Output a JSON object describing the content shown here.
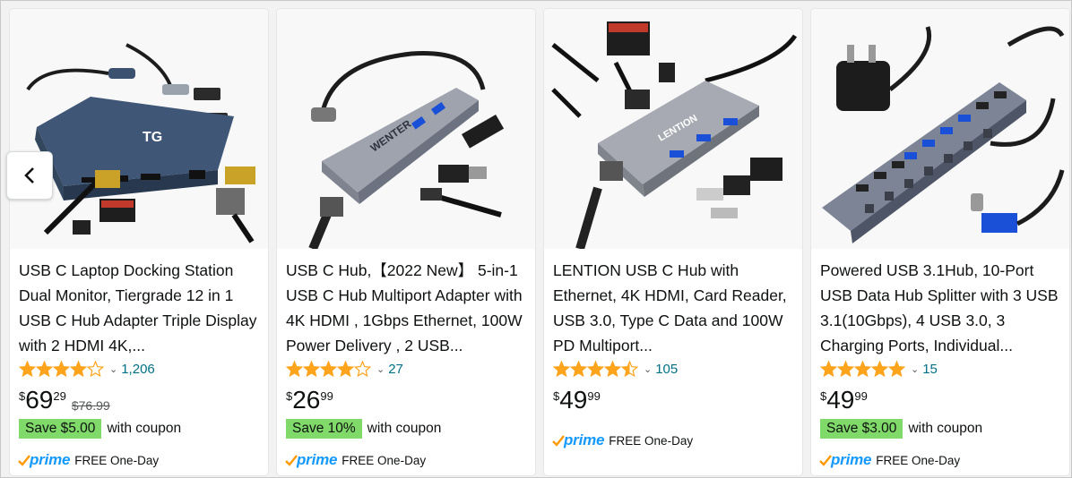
{
  "carousel": {
    "prev_icon": "chevron-left-icon",
    "products": [
      {
        "title": "USB C Laptop Docking Station Dual Monitor, Tiergrade 12 in 1 USB C Hub Adapter Triple Display with 2 HDMI 4K,...",
        "rating": 4.0,
        "rating_count": "1,206",
        "price_symbol": "$",
        "price_whole": "69",
        "price_fraction": "29",
        "list_price": "$76.99",
        "coupon_badge": "Save $5.00",
        "coupon_text": "with coupon",
        "prime_word": "prime",
        "delivery": "FREE One-Day"
      },
      {
        "title": "USB C Hub,【2022 New】 5-in-1 USB C Hub Multiport Adapter with 4K HDMI , 1Gbps Ethernet, 100W Power Delivery , 2 USB...",
        "rating": 4.0,
        "rating_count": "27",
        "price_symbol": "$",
        "price_whole": "26",
        "price_fraction": "99",
        "list_price": "",
        "coupon_badge": "Save 10%",
        "coupon_text": "with coupon",
        "prime_word": "prime",
        "delivery": "FREE One-Day"
      },
      {
        "title": "LENTION USB C Hub with Ethernet, 4K HDMI, Card Reader, USB 3.0, Type C Data and 100W PD Multiport...",
        "rating": 4.5,
        "rating_count": "105",
        "price_symbol": "$",
        "price_whole": "49",
        "price_fraction": "99",
        "list_price": "",
        "coupon_badge": "",
        "coupon_text": "",
        "prime_word": "prime",
        "delivery": "FREE One-Day"
      },
      {
        "title": "Powered USB 3.1Hub, 10-Port USB Data Hub Splitter with 3 USB 3.1(10Gbps), 4 USB 3.0, 3 Charging Ports, Individual...",
        "rating": 5.0,
        "rating_count": "15",
        "price_symbol": "$",
        "price_whole": "49",
        "price_fraction": "99",
        "list_price": "",
        "coupon_badge": "Save $3.00",
        "coupon_text": "with coupon",
        "prime_word": "prime",
        "delivery": "FREE One-Day"
      }
    ]
  },
  "product_image_text": {
    "p1_logo": "TG",
    "p2_brand": "WENTER",
    "p3_brand": "LENTION"
  },
  "colors": {
    "star": "#ffa41c",
    "link": "#007185",
    "coupon": "#7fda69",
    "prime": "#1399ff",
    "prime_check": "#ff9900"
  }
}
